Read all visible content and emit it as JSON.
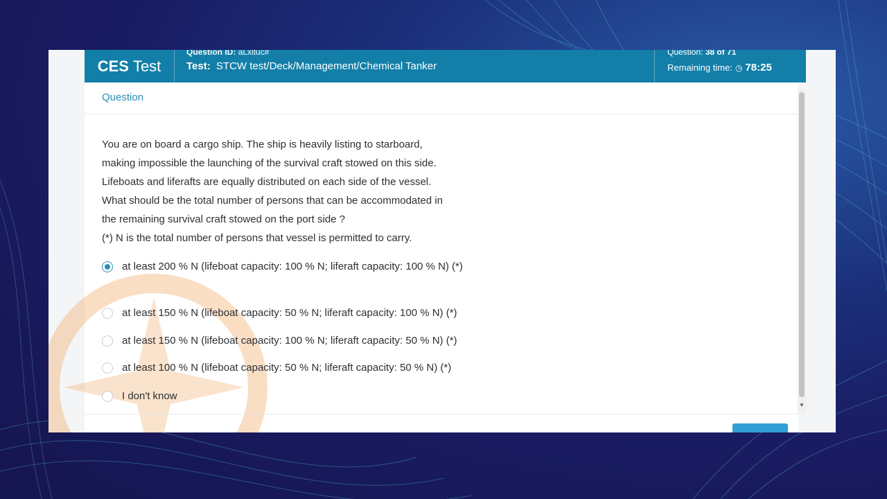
{
  "app": {
    "brand_bold": "CES",
    "brand_light": "Test"
  },
  "header": {
    "question_id_label": "Question ID:",
    "question_id_value": "aLxituc#",
    "test_label": "Test:",
    "test_value": "STCW test/Deck/Management/Chemical Tanker",
    "question_count_label": "Question:",
    "question_count_value": "38 of 71",
    "remaining_label": "Remaining time:",
    "clock_icon": "clock-icon",
    "remaining_value": "78:25"
  },
  "card": {
    "title": "Question",
    "question_lines": [
      "You are on board a cargo ship. The ship is heavily listing to starboard,",
      "making impossible the launching of the survival craft stowed on this side.",
      "Lifeboats and liferafts are equally distributed on each side of the vessel.",
      "What should be the total number of persons that can be accommodated in",
      "the remaining survival craft stowed on the port side ?",
      "(*) N is the total number of persons that vessel is permitted to carry."
    ],
    "options": [
      {
        "label": "at least 200 % N (lifeboat capacity: 100 % N; liferaft capacity: 100 % N) (*)",
        "selected": true
      },
      {
        "label": "at least 150 % N (lifeboat capacity: 50 % N; liferaft capacity: 100 % N) (*)",
        "selected": false
      },
      {
        "label": "at least 150 % N (lifeboat capacity: 100 % N; liferaft capacity: 50 % N) (*)",
        "selected": false
      },
      {
        "label": "at least 100 % N (lifeboat capacity: 50 % N; liferaft capacity: 50 % N) (*)",
        "selected": false
      },
      {
        "label": "I don't know",
        "selected": false
      }
    ]
  },
  "colors": {
    "header": "#137fa8",
    "accent": "#2b8db6",
    "button": "#2f9fd6"
  }
}
